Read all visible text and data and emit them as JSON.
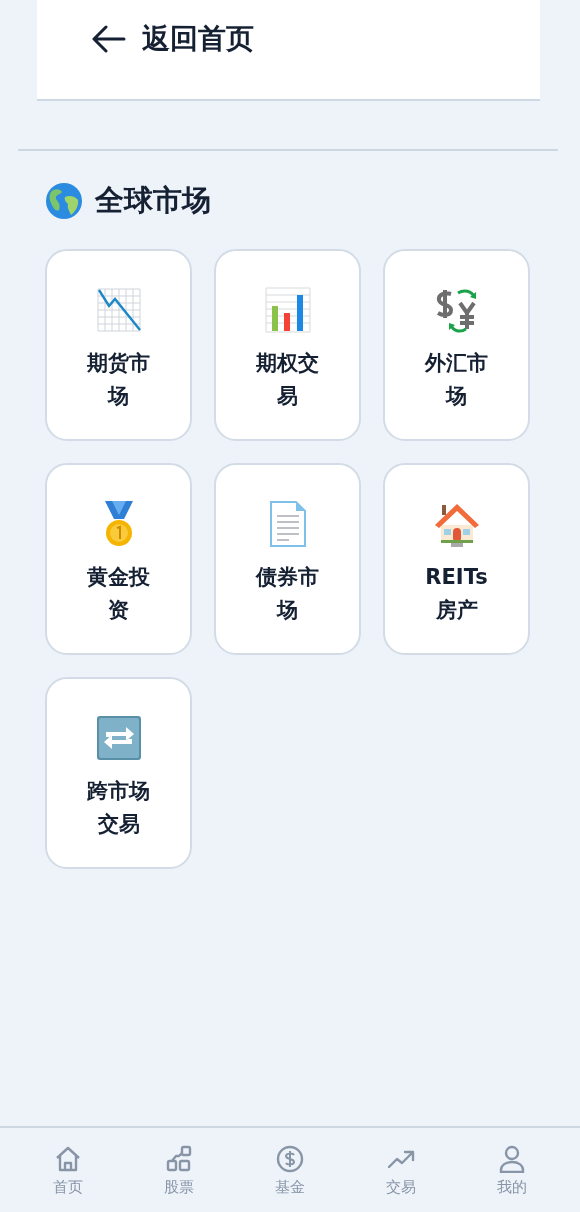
{
  "header": {
    "back_label": "返回首页"
  },
  "section": {
    "title": "全球市场"
  },
  "markets": [
    {
      "label": "期货市场"
    },
    {
      "label": "期权交易"
    },
    {
      "label": "外汇市场"
    },
    {
      "label": "黄金投资"
    },
    {
      "label": "债券市场"
    },
    {
      "label": "REITs房产"
    },
    {
      "label": "跨市场交易"
    }
  ],
  "tab_bar": [
    {
      "label": "首页"
    },
    {
      "label": "股票"
    },
    {
      "label": "基金"
    },
    {
      "label": "交易"
    },
    {
      "label": "我的"
    }
  ]
}
